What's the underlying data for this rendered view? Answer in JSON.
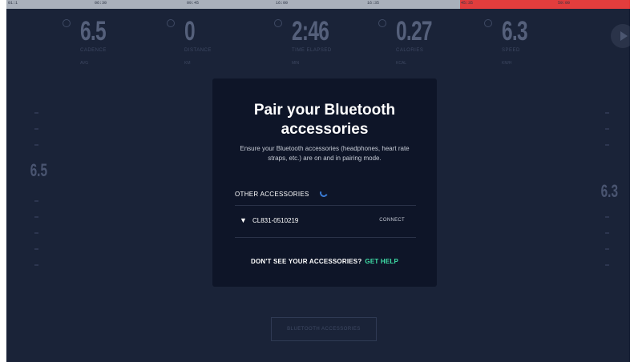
{
  "progress": {
    "ticks": [
      "01:1",
      "06:30",
      "09:45",
      "16:00",
      "16:35",
      "45:35",
      "59:00"
    ],
    "accent_color": "#e23d3d"
  },
  "metrics": [
    {
      "value": "6.5",
      "label": "CADENCE",
      "sub": "AVG"
    },
    {
      "value": "0",
      "label": "DISTANCE",
      "sub": "KM"
    },
    {
      "value": "2:46",
      "label": "TIME ELAPSED",
      "sub": "MIN"
    },
    {
      "value": "0.27",
      "label": "CALORIES",
      "sub": "KCAL"
    },
    {
      "value": "6.3",
      "label": "SPEED",
      "sub": "KM/H"
    }
  ],
  "left_scale_value": "6.5",
  "right_scale_value": "6.3",
  "bottom_button_label": "BLUETOOTH ACCESSORIES",
  "modal": {
    "title": "Pair your Bluetooth accessories",
    "description": "Ensure your Bluetooth accessories (headphones, heart rate straps, etc.) are on and in pairing mode.",
    "section_label": "OTHER ACCESSORIES",
    "accessories": [
      {
        "icon": "bluetooth-icon",
        "name": "CL831-0510219",
        "action": "CONNECT"
      }
    ],
    "help_question": "DON'T SEE YOUR ACCESSORIES?",
    "help_link": "GET HELP",
    "help_color": "#3fe0a8"
  }
}
